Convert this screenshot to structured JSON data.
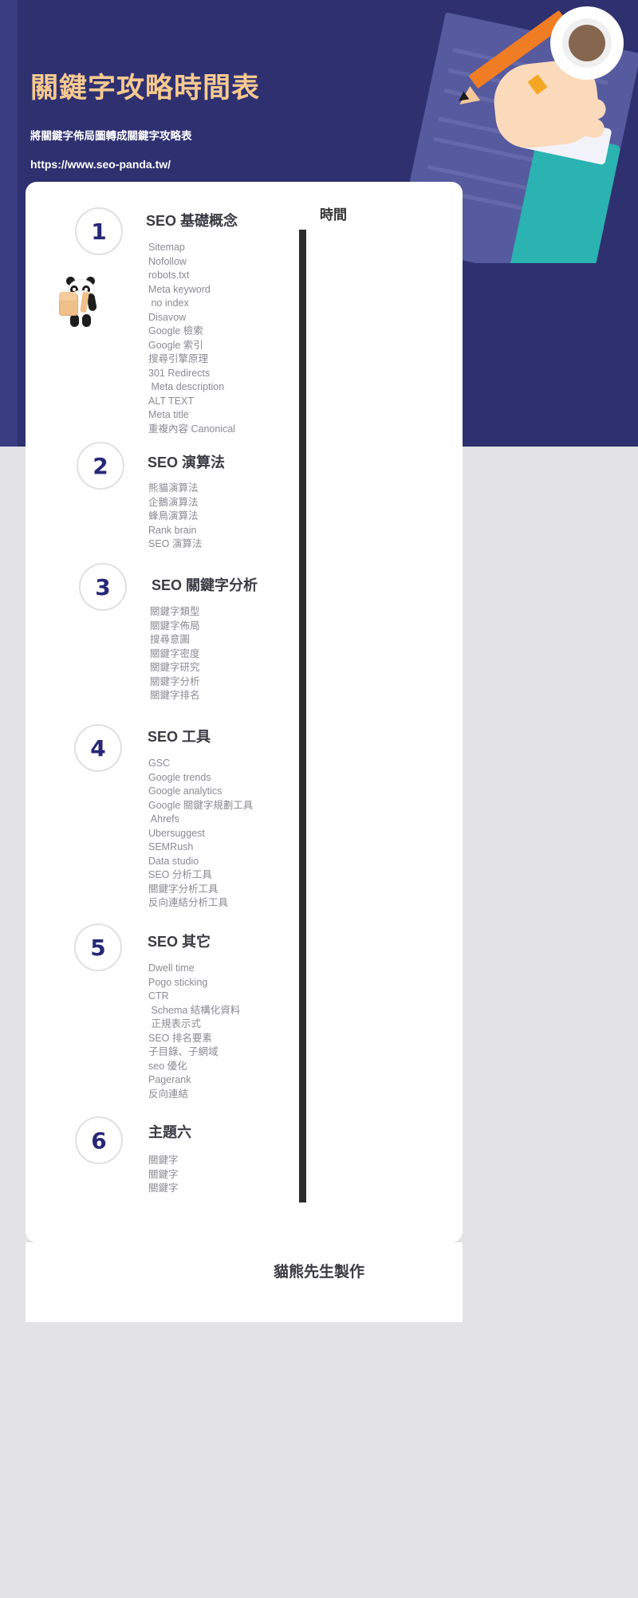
{
  "header": {
    "title": "關鍵字攻略時間表",
    "subtitle": "將關鍵字佈局圖轉成關鍵字攻略表",
    "url": "https://www.seo-panda.tw/"
  },
  "timeline": {
    "column_header": "時間"
  },
  "footer": {
    "credit": "貓熊先生製作"
  },
  "colors": {
    "background_navy": "#2e3070",
    "background_grey": "#e3e3e6",
    "title_orange": "#f8c98f",
    "number_navy": "#262877",
    "list_grey": "#8a8a92",
    "timeline_bar": "#2b2b2b",
    "card_white": "#ffffff"
  },
  "sections": [
    {
      "number": "1",
      "title": "SEO 基礎概念",
      "items": [
        "Sitemap",
        "Nofollow",
        "robots.txt",
        "Meta keyword",
        " no index",
        "Disavow",
        "Google 檢索",
        "Google 索引",
        "搜尋引擎原理",
        "301 Redirects",
        " Meta description",
        "ALT TEXT",
        "Meta title",
        "重複內容 Canonical"
      ]
    },
    {
      "number": "2",
      "title": "SEO 演算法",
      "items": [
        "熊貓演算法",
        "企鵝演算法",
        "蜂鳥演算法",
        "Rank brain",
        "SEO 演算法"
      ]
    },
    {
      "number": "3",
      "title": "SEO 關鍵字分析",
      "items": [
        "關鍵字類型",
        "關鍵字佈局",
        "搜尋意圖",
        "關鍵字密度",
        "關鍵字研究",
        "關鍵字分析",
        "關鍵字排名"
      ]
    },
    {
      "number": "4",
      "title": "SEO 工具",
      "items": [
        "GSC",
        "Google trends",
        "Google analytics",
        "Google 關鍵字規劃工具",
        " Ahrefs",
        "Ubersuggest",
        "SEMRush",
        "Data studio",
        "SEO 分析工具",
        "關鍵字分析工具",
        "反向連結分析工具"
      ]
    },
    {
      "number": "5",
      "title": "SEO 其它",
      "items": [
        "Dwell time",
        "Pogo sticking",
        "CTR",
        " Schema 結構化資料",
        " 正規表示式",
        "SEO 排名要素",
        "子目錄、子網域",
        "seo 優化",
        "Pagerank",
        "反向連結"
      ]
    },
    {
      "number": "6",
      "title": "主題六",
      "items": [
        "關鍵字",
        "關鍵字",
        "關鍵字"
      ]
    }
  ]
}
